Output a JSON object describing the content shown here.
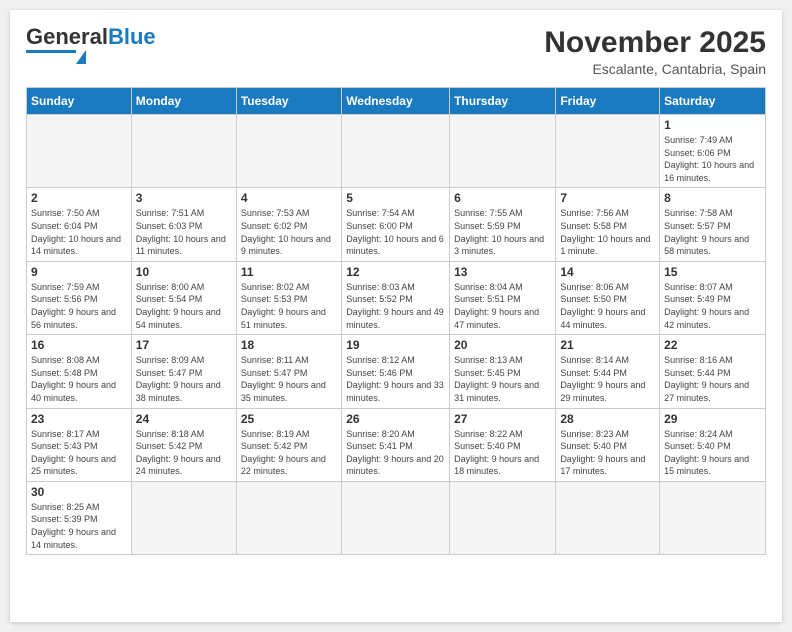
{
  "header": {
    "logo_text_general": "General",
    "logo_text_blue": "Blue",
    "month_year": "November 2025",
    "location": "Escalante, Cantabria, Spain"
  },
  "days_of_week": [
    "Sunday",
    "Monday",
    "Tuesday",
    "Wednesday",
    "Thursday",
    "Friday",
    "Saturday"
  ],
  "weeks": [
    [
      {
        "day": "",
        "info": ""
      },
      {
        "day": "",
        "info": ""
      },
      {
        "day": "",
        "info": ""
      },
      {
        "day": "",
        "info": ""
      },
      {
        "day": "",
        "info": ""
      },
      {
        "day": "",
        "info": ""
      },
      {
        "day": "1",
        "info": "Sunrise: 7:49 AM\nSunset: 6:06 PM\nDaylight: 10 hours and 16 minutes."
      }
    ],
    [
      {
        "day": "2",
        "info": "Sunrise: 7:50 AM\nSunset: 6:04 PM\nDaylight: 10 hours and 14 minutes."
      },
      {
        "day": "3",
        "info": "Sunrise: 7:51 AM\nSunset: 6:03 PM\nDaylight: 10 hours and 11 minutes."
      },
      {
        "day": "4",
        "info": "Sunrise: 7:53 AM\nSunset: 6:02 PM\nDaylight: 10 hours and 9 minutes."
      },
      {
        "day": "5",
        "info": "Sunrise: 7:54 AM\nSunset: 6:00 PM\nDaylight: 10 hours and 6 minutes."
      },
      {
        "day": "6",
        "info": "Sunrise: 7:55 AM\nSunset: 5:59 PM\nDaylight: 10 hours and 3 minutes."
      },
      {
        "day": "7",
        "info": "Sunrise: 7:56 AM\nSunset: 5:58 PM\nDaylight: 10 hours and 1 minute."
      },
      {
        "day": "8",
        "info": "Sunrise: 7:58 AM\nSunset: 5:57 PM\nDaylight: 9 hours and 58 minutes."
      }
    ],
    [
      {
        "day": "9",
        "info": "Sunrise: 7:59 AM\nSunset: 5:56 PM\nDaylight: 9 hours and 56 minutes."
      },
      {
        "day": "10",
        "info": "Sunrise: 8:00 AM\nSunset: 5:54 PM\nDaylight: 9 hours and 54 minutes."
      },
      {
        "day": "11",
        "info": "Sunrise: 8:02 AM\nSunset: 5:53 PM\nDaylight: 9 hours and 51 minutes."
      },
      {
        "day": "12",
        "info": "Sunrise: 8:03 AM\nSunset: 5:52 PM\nDaylight: 9 hours and 49 minutes."
      },
      {
        "day": "13",
        "info": "Sunrise: 8:04 AM\nSunset: 5:51 PM\nDaylight: 9 hours and 47 minutes."
      },
      {
        "day": "14",
        "info": "Sunrise: 8:06 AM\nSunset: 5:50 PM\nDaylight: 9 hours and 44 minutes."
      },
      {
        "day": "15",
        "info": "Sunrise: 8:07 AM\nSunset: 5:49 PM\nDaylight: 9 hours and 42 minutes."
      }
    ],
    [
      {
        "day": "16",
        "info": "Sunrise: 8:08 AM\nSunset: 5:48 PM\nDaylight: 9 hours and 40 minutes."
      },
      {
        "day": "17",
        "info": "Sunrise: 8:09 AM\nSunset: 5:47 PM\nDaylight: 9 hours and 38 minutes."
      },
      {
        "day": "18",
        "info": "Sunrise: 8:11 AM\nSunset: 5:47 PM\nDaylight: 9 hours and 35 minutes."
      },
      {
        "day": "19",
        "info": "Sunrise: 8:12 AM\nSunset: 5:46 PM\nDaylight: 9 hours and 33 minutes."
      },
      {
        "day": "20",
        "info": "Sunrise: 8:13 AM\nSunset: 5:45 PM\nDaylight: 9 hours and 31 minutes."
      },
      {
        "day": "21",
        "info": "Sunrise: 8:14 AM\nSunset: 5:44 PM\nDaylight: 9 hours and 29 minutes."
      },
      {
        "day": "22",
        "info": "Sunrise: 8:16 AM\nSunset: 5:44 PM\nDaylight: 9 hours and 27 minutes."
      }
    ],
    [
      {
        "day": "23",
        "info": "Sunrise: 8:17 AM\nSunset: 5:43 PM\nDaylight: 9 hours and 25 minutes."
      },
      {
        "day": "24",
        "info": "Sunrise: 8:18 AM\nSunset: 5:42 PM\nDaylight: 9 hours and 24 minutes."
      },
      {
        "day": "25",
        "info": "Sunrise: 8:19 AM\nSunset: 5:42 PM\nDaylight: 9 hours and 22 minutes."
      },
      {
        "day": "26",
        "info": "Sunrise: 8:20 AM\nSunset: 5:41 PM\nDaylight: 9 hours and 20 minutes."
      },
      {
        "day": "27",
        "info": "Sunrise: 8:22 AM\nSunset: 5:40 PM\nDaylight: 9 hours and 18 minutes."
      },
      {
        "day": "28",
        "info": "Sunrise: 8:23 AM\nSunset: 5:40 PM\nDaylight: 9 hours and 17 minutes."
      },
      {
        "day": "29",
        "info": "Sunrise: 8:24 AM\nSunset: 5:40 PM\nDaylight: 9 hours and 15 minutes."
      }
    ],
    [
      {
        "day": "30",
        "info": "Sunrise: 8:25 AM\nSunset: 5:39 PM\nDaylight: 9 hours and 14 minutes."
      },
      {
        "day": "",
        "info": ""
      },
      {
        "day": "",
        "info": ""
      },
      {
        "day": "",
        "info": ""
      },
      {
        "day": "",
        "info": ""
      },
      {
        "day": "",
        "info": ""
      },
      {
        "day": "",
        "info": ""
      }
    ]
  ]
}
